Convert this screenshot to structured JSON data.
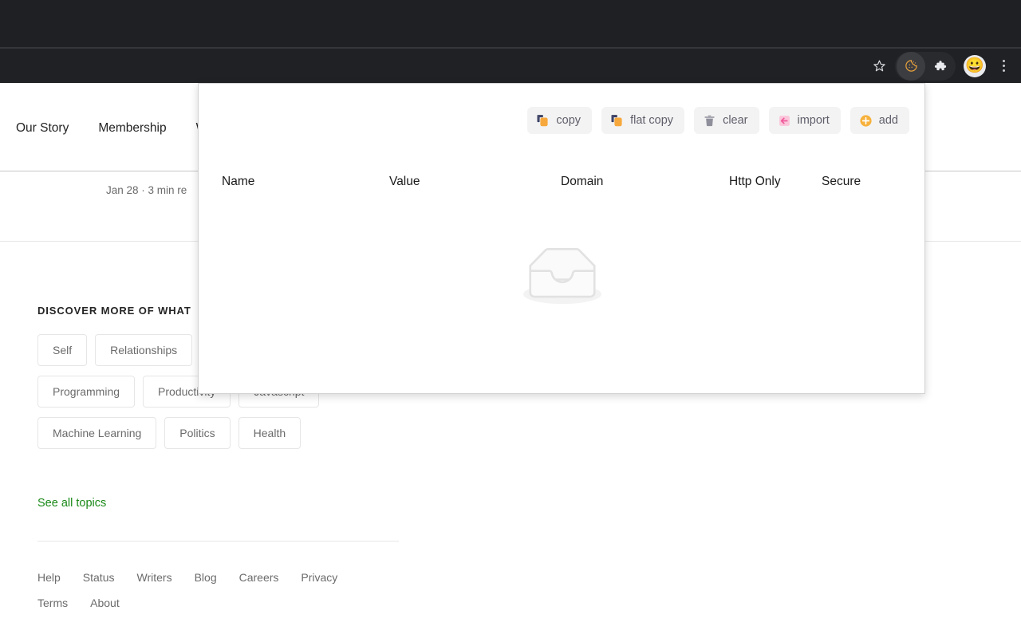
{
  "browser": {
    "toolbar_icons": [
      {
        "name": "bookmark-star-icon",
        "glyph": "star"
      },
      {
        "name": "cookie-editor-extension-icon",
        "glyph": "cookie"
      },
      {
        "name": "extensions-puzzle-icon",
        "glyph": "puzzle"
      },
      {
        "name": "profile-avatar-icon",
        "glyph": "😀"
      },
      {
        "name": "chrome-menu-icon",
        "glyph": "kebab"
      }
    ]
  },
  "page": {
    "nav_links": [
      "Our Story",
      "Membership",
      "W"
    ],
    "article_meta": "Jan 28  ·  3 min re",
    "discover_title": "DISCOVER MORE OF WHAT",
    "topic_rows": [
      [
        "Self",
        "Relationships"
      ],
      [
        "Programming",
        "Productivity",
        "Javascript"
      ],
      [
        "Machine Learning",
        "Politics",
        "Health"
      ]
    ],
    "see_all_topics": "See all topics",
    "footer_links": [
      "Help",
      "Status",
      "Writers",
      "Blog",
      "Careers",
      "Privacy",
      "Terms",
      "About"
    ],
    "accent_green": "#1a8917"
  },
  "popup": {
    "buttons": [
      {
        "label": "copy",
        "icon": "copy-icon",
        "color": "#f5a623"
      },
      {
        "label": "flat copy",
        "icon": "flat-copy-icon",
        "color": "#f5a623"
      },
      {
        "label": "clear",
        "icon": "trash-icon",
        "color": "#8c8c99"
      },
      {
        "label": "import",
        "icon": "import-arrow-icon",
        "color": "#f06292"
      },
      {
        "label": "add",
        "icon": "add-circle-icon",
        "color": "#f5a623"
      }
    ],
    "columns": [
      "Name",
      "Value",
      "Domain",
      "Http Only",
      "Secure"
    ],
    "empty_state_icon": "empty-inbox-icon",
    "rows": []
  }
}
